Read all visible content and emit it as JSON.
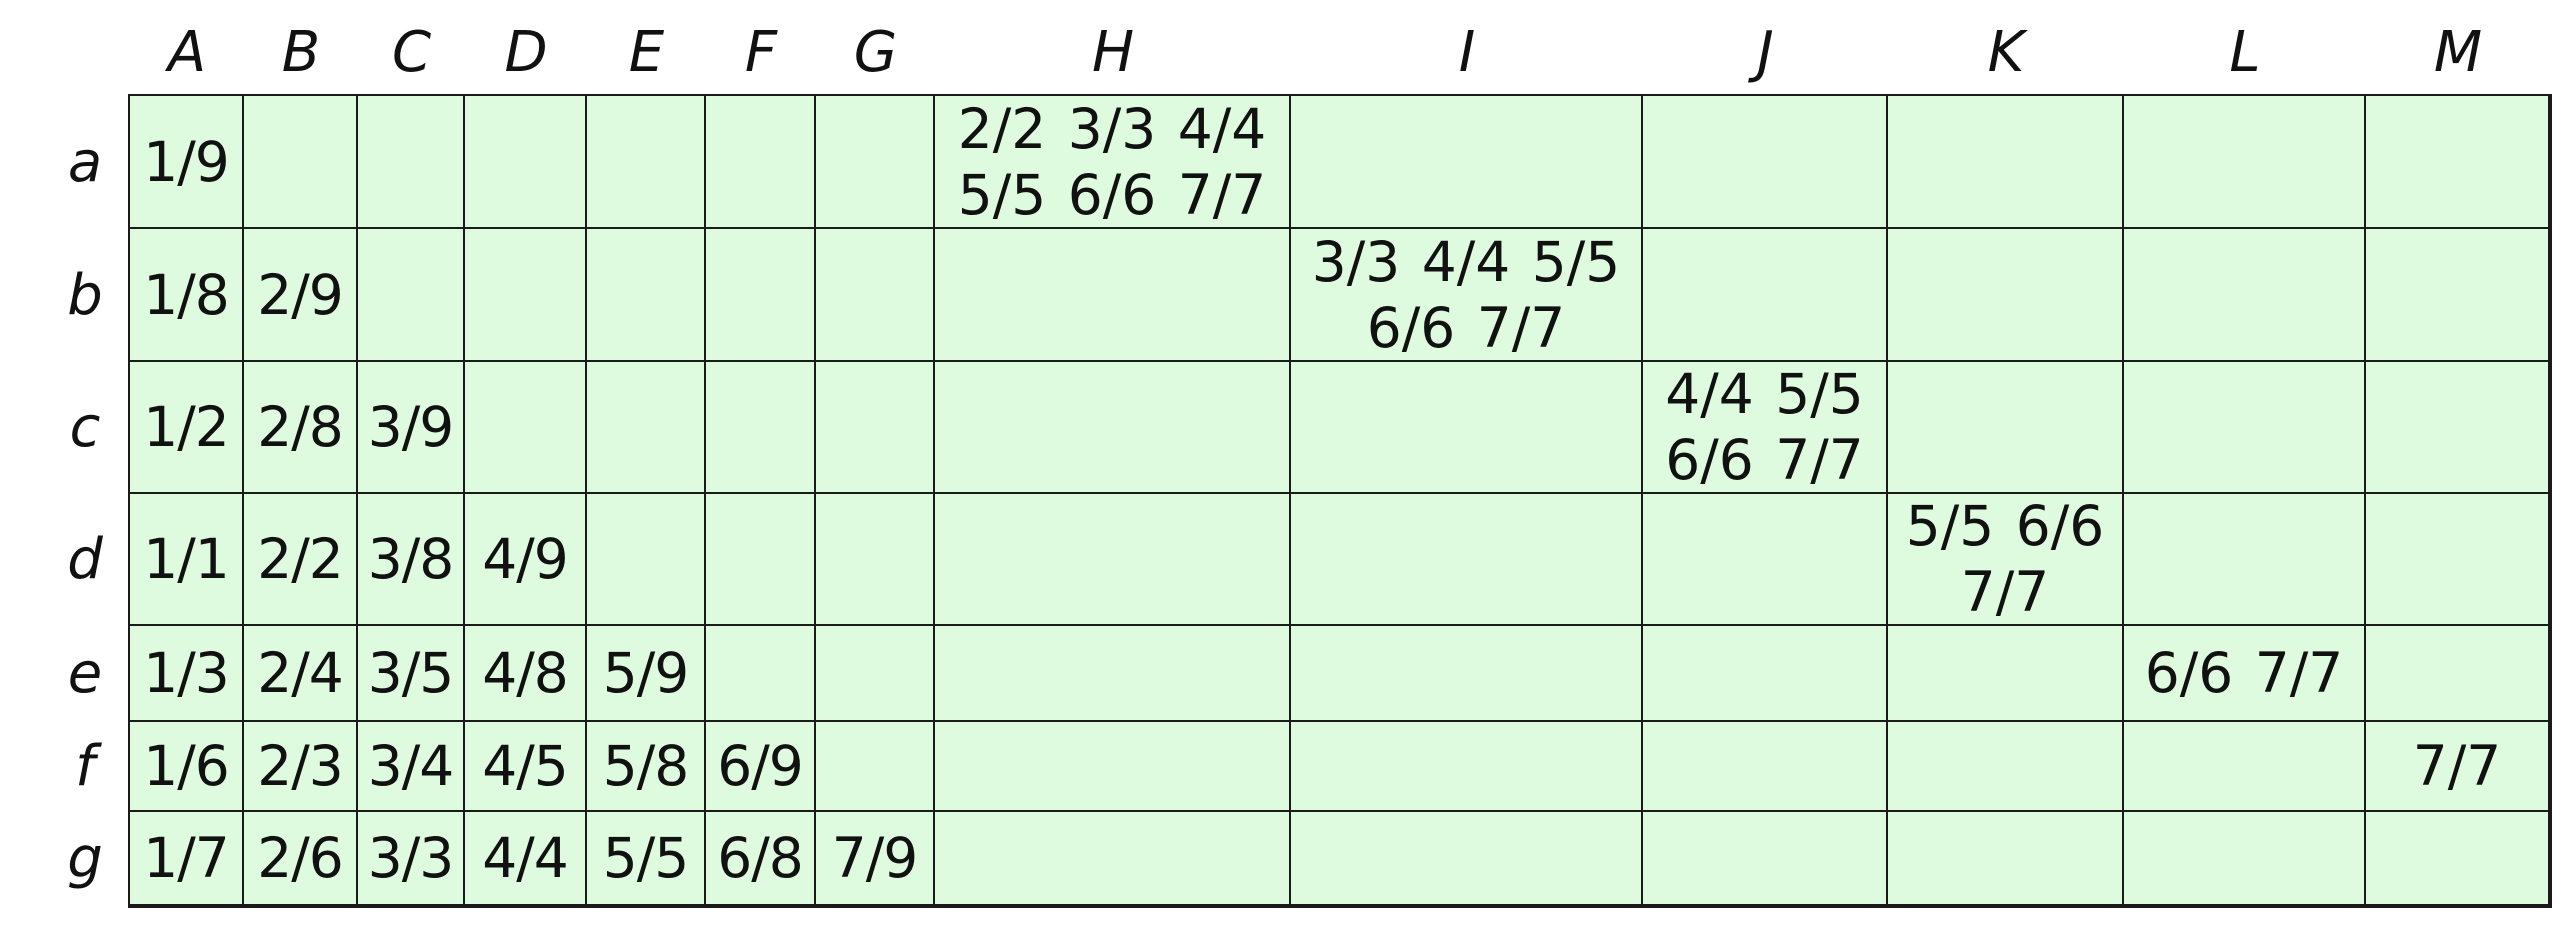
{
  "grid": {
    "columns": [
      "A",
      "B",
      "C",
      "D",
      "E",
      "F",
      "G",
      "H",
      "I",
      "J",
      "K",
      "L",
      "M"
    ],
    "rows": [
      "a",
      "b",
      "c",
      "d",
      "e",
      "f",
      "g"
    ],
    "cells": [
      [
        "1/9",
        "",
        "",
        "",
        "",
        "",
        "",
        "2/2 3/3 4/4 5/5 6/6 7/7",
        "",
        "",
        "",
        "",
        ""
      ],
      [
        "1/8",
        "2/9",
        "",
        "",
        "",
        "",
        "",
        "",
        "3/3 4/4 5/5 6/6 7/7",
        "",
        "",
        "",
        ""
      ],
      [
        "1/2",
        "2/8",
        "3/9",
        "",
        "",
        "",
        "",
        "",
        "",
        "4/4 5/5 6/6 7/7",
        "",
        "",
        ""
      ],
      [
        "1/1",
        "2/2",
        "3/8",
        "4/9",
        "",
        "",
        "",
        "",
        "",
        "",
        "5/5 6/6 7/7",
        "",
        ""
      ],
      [
        "1/3",
        "2/4",
        "3/5",
        "4/8",
        "5/9",
        "",
        "",
        "",
        "",
        "",
        "",
        "6/6 7/7",
        ""
      ],
      [
        "1/6",
        "2/3",
        "3/4",
        "4/5",
        "5/8",
        "6/9",
        "",
        "",
        "",
        "",
        "",
        "",
        "7/7"
      ],
      [
        "1/7",
        "2/6",
        "3/3",
        "4/4",
        "5/5",
        "6/8",
        "7/9",
        "",
        "",
        "",
        "",
        "",
        ""
      ]
    ],
    "colors": {
      "cell_fill": "#dffbdf",
      "grid_line": "#1a1a1a",
      "text": "#111111"
    }
  }
}
